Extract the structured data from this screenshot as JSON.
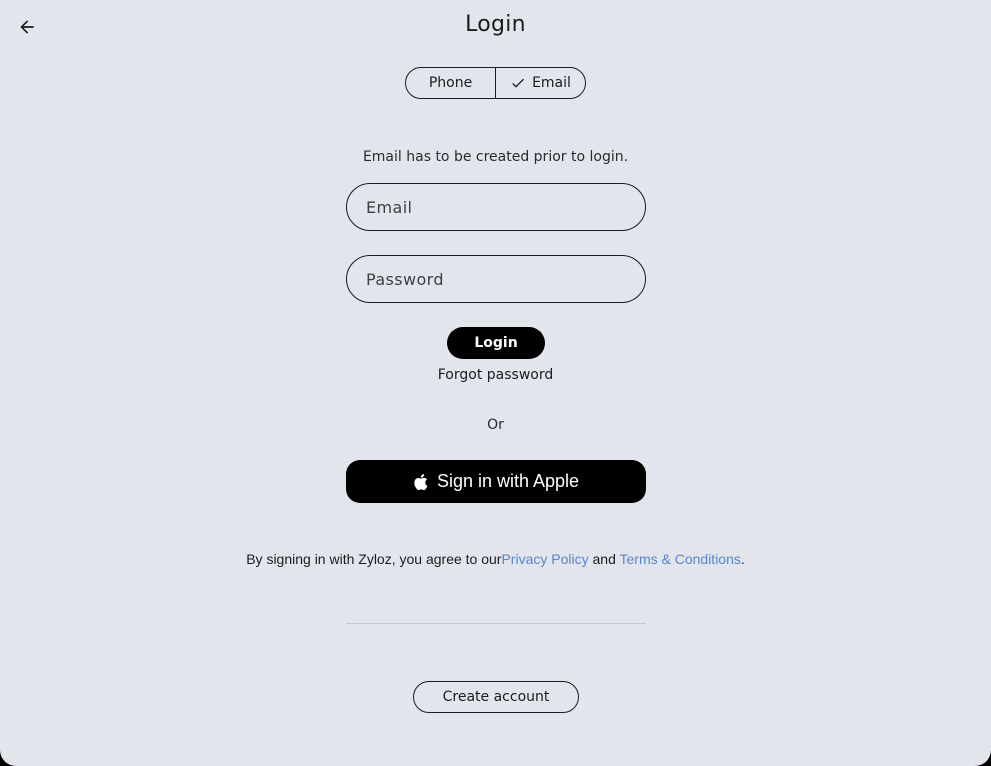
{
  "header": {
    "title": "Login",
    "back_icon": "arrow-left-icon"
  },
  "login_method": {
    "options": [
      {
        "label": "Phone",
        "selected": false
      },
      {
        "label": "Email",
        "selected": true,
        "icon": "check-icon"
      }
    ]
  },
  "form": {
    "hint": "Email has to be created prior to login.",
    "email_placeholder": "Email",
    "password_placeholder": "Password",
    "login_label": "Login",
    "forgot_label": "Forgot password"
  },
  "alt": {
    "or_label": "Or",
    "apple_label": "Sign in with Apple",
    "apple_icon": "apple-logo-icon"
  },
  "terms": {
    "prefix": "By signing in with Zyloz, you agree to our",
    "privacy_label": "Privacy Policy",
    "and_label": " and ",
    "terms_label": "Terms & Conditions",
    "suffix": "."
  },
  "footer": {
    "create_label": "Create account"
  },
  "colors": {
    "background": "#e2e6ec",
    "primary_button": "#000000",
    "link": "#5b83c7"
  }
}
